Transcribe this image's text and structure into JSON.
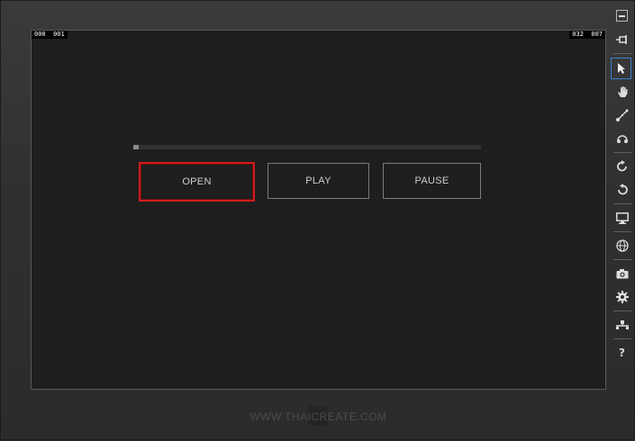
{
  "overlay": {
    "coord_top_left": "000  001",
    "coord_top_right": "032  007"
  },
  "progress": {
    "value": 0.0
  },
  "buttons": {
    "open_label": "OPEN",
    "play_label": "PLAY",
    "pause_label": "PAUSE"
  },
  "toolbar": {
    "items": [
      {
        "icon": "minimize-icon"
      },
      {
        "icon": "pin-icon"
      },
      {
        "icon": "pointer-icon",
        "selected": true
      },
      {
        "icon": "hand-icon"
      },
      {
        "icon": "pinch-zoom-icon"
      },
      {
        "icon": "gesture-icon"
      },
      {
        "icon": "rotate-clockwise-icon"
      },
      {
        "icon": "rotate-counterclockwise-icon"
      },
      {
        "icon": "monitor-icon"
      },
      {
        "icon": "globe-icon"
      },
      {
        "icon": "camera-icon"
      },
      {
        "icon": "gear-icon"
      },
      {
        "icon": "network-icon"
      },
      {
        "icon": "help-icon",
        "glyph": "?"
      }
    ]
  },
  "watermark": {
    "text": "WWW.THAICREATE.COM"
  },
  "colors": {
    "accent_selected": "#3b7fcf",
    "open_button_border": "#d21b1b",
    "background": "#1e1e1e"
  }
}
